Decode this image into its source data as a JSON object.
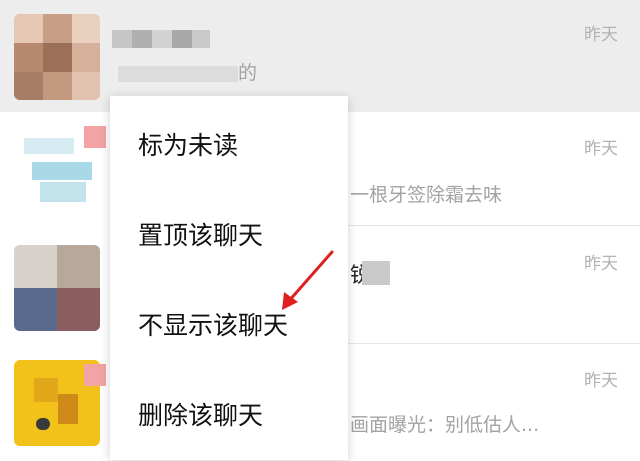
{
  "chats": [
    {
      "time": "昨天",
      "preview": "的"
    },
    {
      "time": "昨天",
      "preview": "一根牙签除霜去味"
    },
    {
      "time": "昨天",
      "preview": "锐"
    },
    {
      "time": "昨天",
      "preview": "画面曝光：别低估人..."
    }
  ],
  "context_menu": {
    "items": [
      {
        "label": "标为未读"
      },
      {
        "label": "置顶该聊天"
      },
      {
        "label": "不显示该聊天"
      },
      {
        "label": "删除该聊天"
      }
    ]
  },
  "colors": {
    "highlight_row": "#ededed",
    "annotation_arrow": "#e02020",
    "time_text": "#b2b2b2"
  }
}
